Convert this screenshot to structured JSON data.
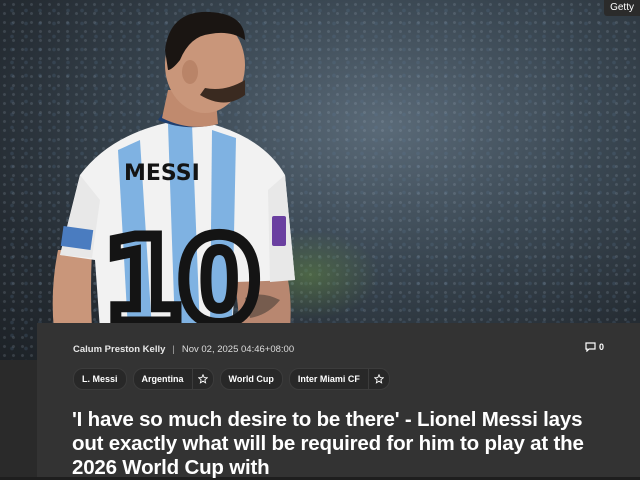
{
  "hero": {
    "credit": "Getty",
    "jersey_name": "MESSI",
    "jersey_number": "10"
  },
  "article": {
    "author": "Calum Preston Kelly",
    "separator": "|",
    "date": "Nov 02, 2025 04:46+08:00",
    "comment_count": "0",
    "tags": [
      {
        "label": "L. Messi",
        "followable": false
      },
      {
        "label": "Argentina",
        "followable": true
      },
      {
        "label": "World Cup",
        "followable": false
      },
      {
        "label": "Inter Miami CF",
        "followable": true
      }
    ],
    "headline": "'I have so much desire to be there' - Lionel Messi lays out exactly what will be required for him to play at the 2026 World Cup with"
  },
  "colors": {
    "card_bg": "#333333",
    "page_bg": "#1e1e1e",
    "jersey_blue": "#7fb2e2",
    "text": "#ffffff"
  },
  "icons": [
    "comment-icon",
    "star-icon"
  ]
}
